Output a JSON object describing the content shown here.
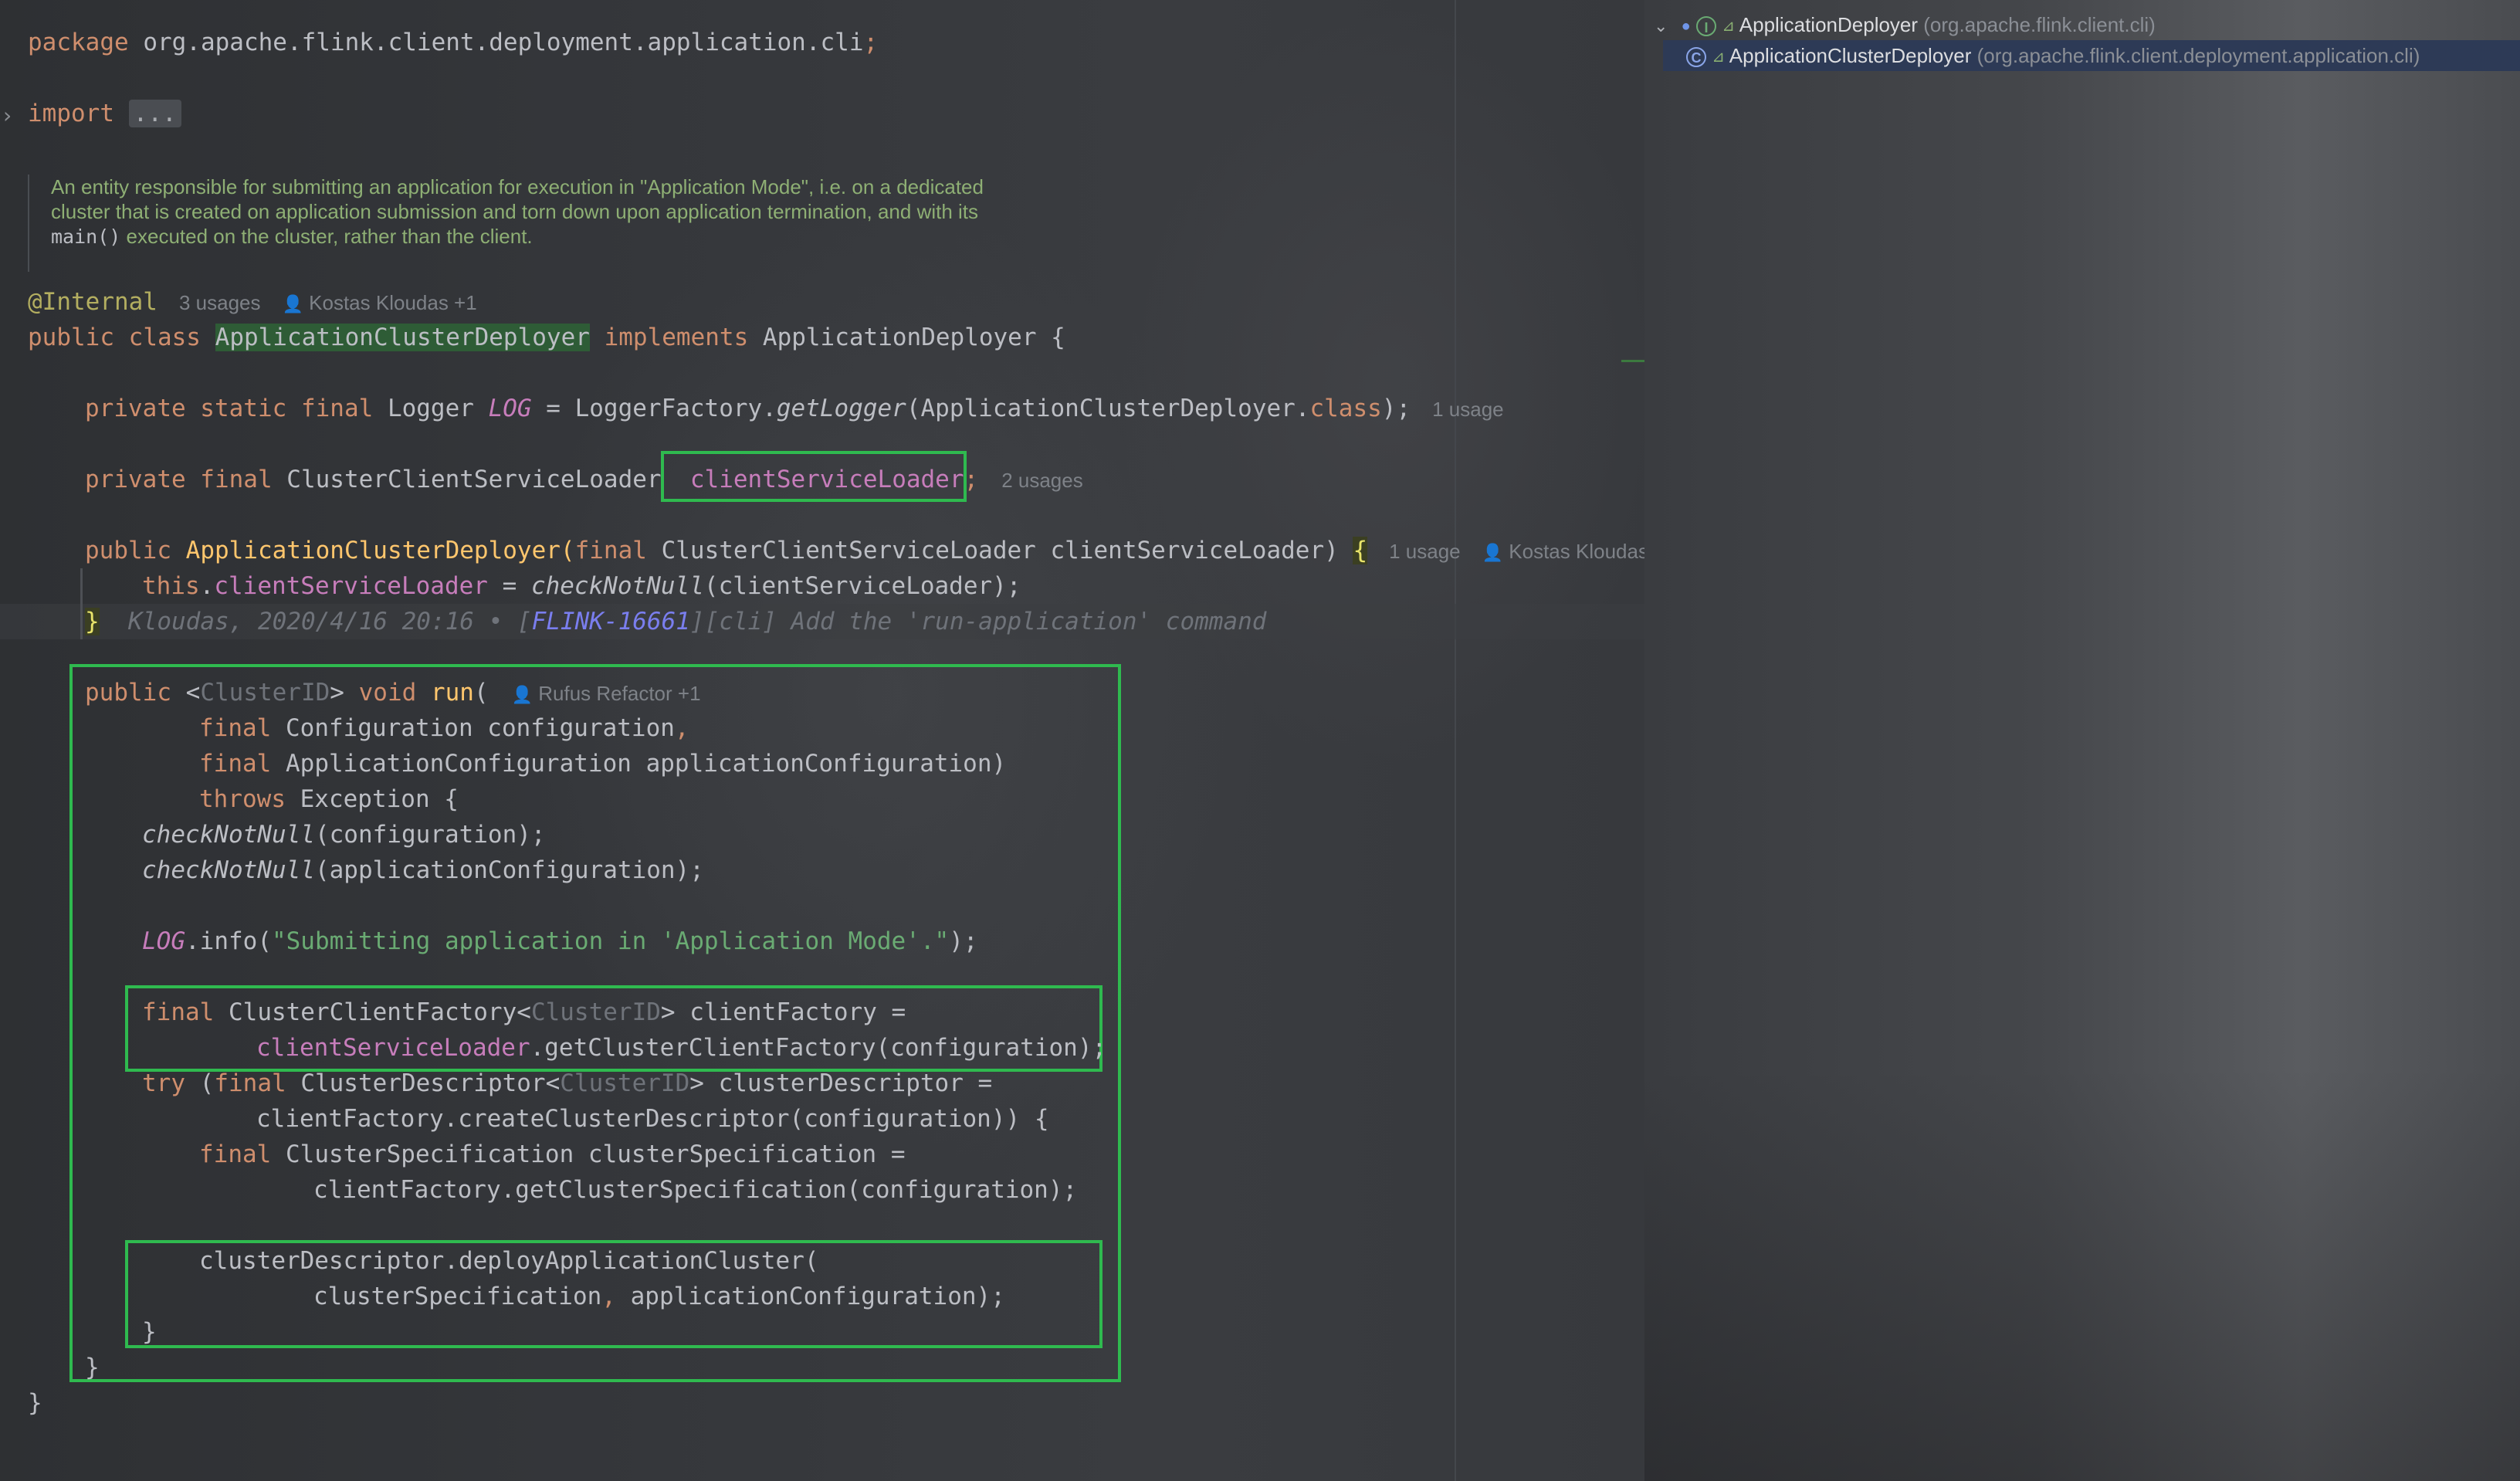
{
  "editor": {
    "package_line": [
      "package",
      " org.apache.flink.client.deployment.application.cli",
      ";"
    ],
    "import_kw": "import",
    "import_dots": "...",
    "javadoc": {
      "line1": "An entity responsible for submitting an application for execution in \"Application Mode\", i.e. on a dedicated",
      "line2": "cluster that is created on application submission and torn down upon application termination, and with its",
      "line3_code": "main()",
      "line3_text": " executed on the cluster, rather than the client."
    },
    "annotation": "@Internal",
    "annotation_usages": "3 usages",
    "annotation_author": "Kostas Kloudas +1",
    "class_decl": {
      "public": "public",
      "class": "class",
      "name": "ApplicationClusterDeployer",
      "implements": "implements",
      "iface": "ApplicationDeployer {"
    },
    "logger_line": {
      "mods": "private static final",
      "type": " Logger ",
      "field": "LOG",
      "rest1": " = LoggerFactory.",
      "method": "getLogger",
      "rest2": "(ApplicationClusterDeployer.",
      "class_kw": "class",
      "rest3": ");",
      "hint": "1 usage"
    },
    "field_line": {
      "mods": "private final",
      "type": " ClusterClientServiceLoader ",
      "field": "clientServiceLoader",
      "semi": ";",
      "hint": "2 usages"
    },
    "ctor_line": {
      "public": "public",
      "name": "ApplicationClusterDeployer",
      "paren": "(",
      "final": "final",
      "rest": " ClusterClientServiceLoader clientServiceLoader) ",
      "brace": "{",
      "hint": "1 usage",
      "author": "Kostas Kloudas"
    },
    "ctor_body": {
      "this": "this",
      "dot": ".",
      "field": "clientServiceLoader",
      "eq": " = ",
      "call": "checkNotNull",
      "rest": "(clientServiceLoader);"
    },
    "ctor_close": {
      "brace": "}",
      "blame_pre": "Kloudas, 2020/4/16 20:16 • [",
      "blame_link": "FLINK-16661",
      "blame_post": "][cli] Add the 'run-application' command"
    },
    "run_method": {
      "l1_public": "public",
      "l1_lt": " <",
      "l1_tp": "ClusterID",
      "l1_gt": "> ",
      "l1_void": "void",
      "l1_name": " run",
      "l1_paren": "(",
      "l1_author": "Rufus Refactor +1",
      "l2_final": "final",
      "l2_rest": " Configuration configuration",
      "l2_comma": ",",
      "l3_final": "final",
      "l3_rest": " ApplicationConfiguration applicationConfiguration)",
      "l4_throws": "throws",
      "l4_rest": " Exception {",
      "l5_call": "checkNotNull",
      "l5_rest": "(configuration);",
      "l6_call": "checkNotNull",
      "l6_rest": "(applicationConfiguration);",
      "l7_log": "LOG",
      "l7_mid": ".info(",
      "l7_str": "\"Submitting application in 'Application Mode'.\"",
      "l7_end": ");",
      "l8_final": "final",
      "l8_type": " ClusterClientFactory<",
      "l8_tp": "ClusterID",
      "l8_rest": "> clientFactory =",
      "l9_field": "clientServiceLoader",
      "l9_rest": ".getClusterClientFactory(configuration);",
      "l10_try": "try",
      "l10_p": " (",
      "l10_final": "final",
      "l10_type": " ClusterDescriptor<",
      "l10_tp": "ClusterID",
      "l10_rest": "> clusterDescriptor =",
      "l11": "clientFactory.createClusterDescriptor(configuration)) {",
      "l12_final": "final",
      "l12_rest": " ClusterSpecification clusterSpecification =",
      "l13": "clientFactory.getClusterSpecification(configuration);",
      "l14": "clusterDescriptor.deployApplicationCluster(",
      "l15_a": "clusterSpecification",
      "l15_comma": ",",
      "l15_b": " applicationConfiguration);",
      "l16": "}",
      "l17": "}"
    },
    "class_close": "}"
  },
  "structure": {
    "parent_name": "ApplicationDeployer",
    "parent_pkg": " (org.apache.flink.client.cli)",
    "child_name": "ApplicationClusterDeployer",
    "child_pkg": " (org.apache.flink.client.deployment.application.cli)"
  },
  "colors": {
    "highlight_box": "#2fba4f",
    "keyword": "#cf8e6d",
    "field": "#c77dbb",
    "string": "#6aab73",
    "method_decl": "#ffc66d",
    "selection": "#2d3a56"
  },
  "icons": [
    "fold-arrow-icon",
    "user-icon",
    "interface-icon",
    "class-icon",
    "chevron-down-icon",
    "link-icon"
  ]
}
